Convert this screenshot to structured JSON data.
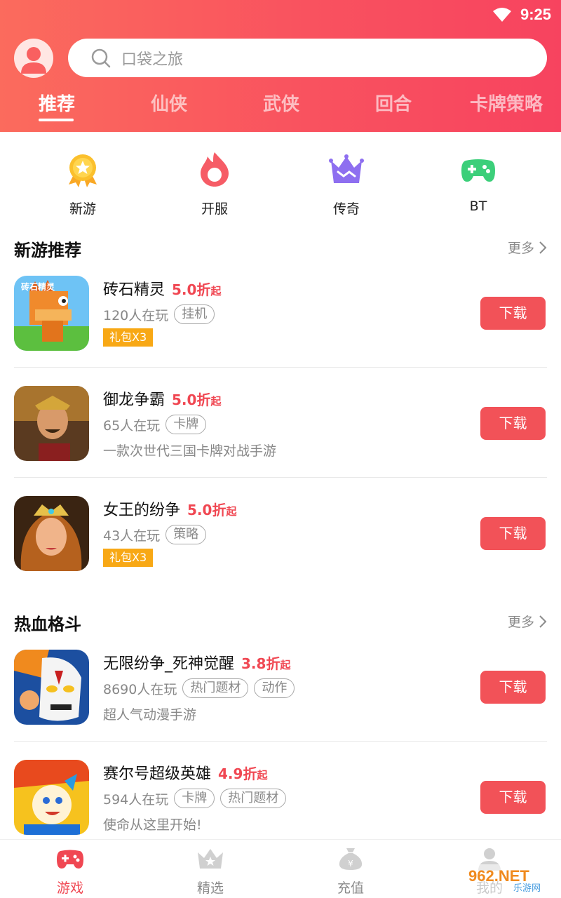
{
  "status": {
    "time": "9:25",
    "wifi_icon": "wifi-icon"
  },
  "header": {
    "search_placeholder": "口袋之旅",
    "tabs": [
      {
        "label": "推荐",
        "active": true
      },
      {
        "label": "仙侠",
        "active": false
      },
      {
        "label": "武侠",
        "active": false
      },
      {
        "label": "回合",
        "active": false
      },
      {
        "label": "卡牌策略",
        "active": false
      }
    ]
  },
  "categories": [
    {
      "label": "新游",
      "icon": "star-medal-icon"
    },
    {
      "label": "开服",
      "icon": "flame-icon"
    },
    {
      "label": "传奇",
      "icon": "crown-icon"
    },
    {
      "label": "BT",
      "icon": "gamepad-icon"
    }
  ],
  "sections": [
    {
      "title": "新游推荐",
      "more": "更多",
      "games": [
        {
          "name": "砖石精灵",
          "discount": "5.0折",
          "discount_suffix": "起",
          "players": "120人在玩",
          "tags": [
            "挂机"
          ],
          "badge": "礼包X3",
          "desc": "",
          "button": "下载"
        },
        {
          "name": "御龙争霸",
          "discount": "5.0折",
          "discount_suffix": "起",
          "players": "65人在玩",
          "tags": [
            "卡牌"
          ],
          "badge": "",
          "desc": "一款次世代三国卡牌对战手游",
          "button": "下载"
        },
        {
          "name": "女王的纷争",
          "discount": "5.0折",
          "discount_suffix": "起",
          "players": "43人在玩",
          "tags": [
            "策略"
          ],
          "badge": "礼包X3",
          "desc": "",
          "button": "下载"
        }
      ]
    },
    {
      "title": "热血格斗",
      "more": "更多",
      "games": [
        {
          "name": "无限纷争_死神觉醒",
          "discount": "3.8折",
          "discount_suffix": "起",
          "players": "8690人在玩",
          "tags": [
            "热门题材",
            "动作"
          ],
          "badge": "",
          "desc": "超人气动漫手游",
          "button": "下载"
        },
        {
          "name": "赛尔号超级英雄",
          "discount": "4.9折",
          "discount_suffix": "起",
          "players": "594人在玩",
          "tags": [
            "卡牌",
            "热门题材"
          ],
          "badge": "",
          "desc": "使命从这里开始!",
          "button": "下载"
        }
      ]
    }
  ],
  "bottom_nav": [
    {
      "label": "游戏",
      "icon": "gamepad-icon",
      "active": true
    },
    {
      "label": "精选",
      "icon": "crown-icon",
      "active": false
    },
    {
      "label": "充值",
      "icon": "money-bag-icon",
      "active": false
    },
    {
      "label": "我的",
      "icon": "user-icon",
      "active": false
    }
  ],
  "watermark": {
    "text": "962.NET",
    "subtext": "乐游网"
  },
  "colors": {
    "accent": "#f25258",
    "header_start": "#fb6b5d",
    "header_end": "#f7435f",
    "badge": "#f8a815"
  }
}
